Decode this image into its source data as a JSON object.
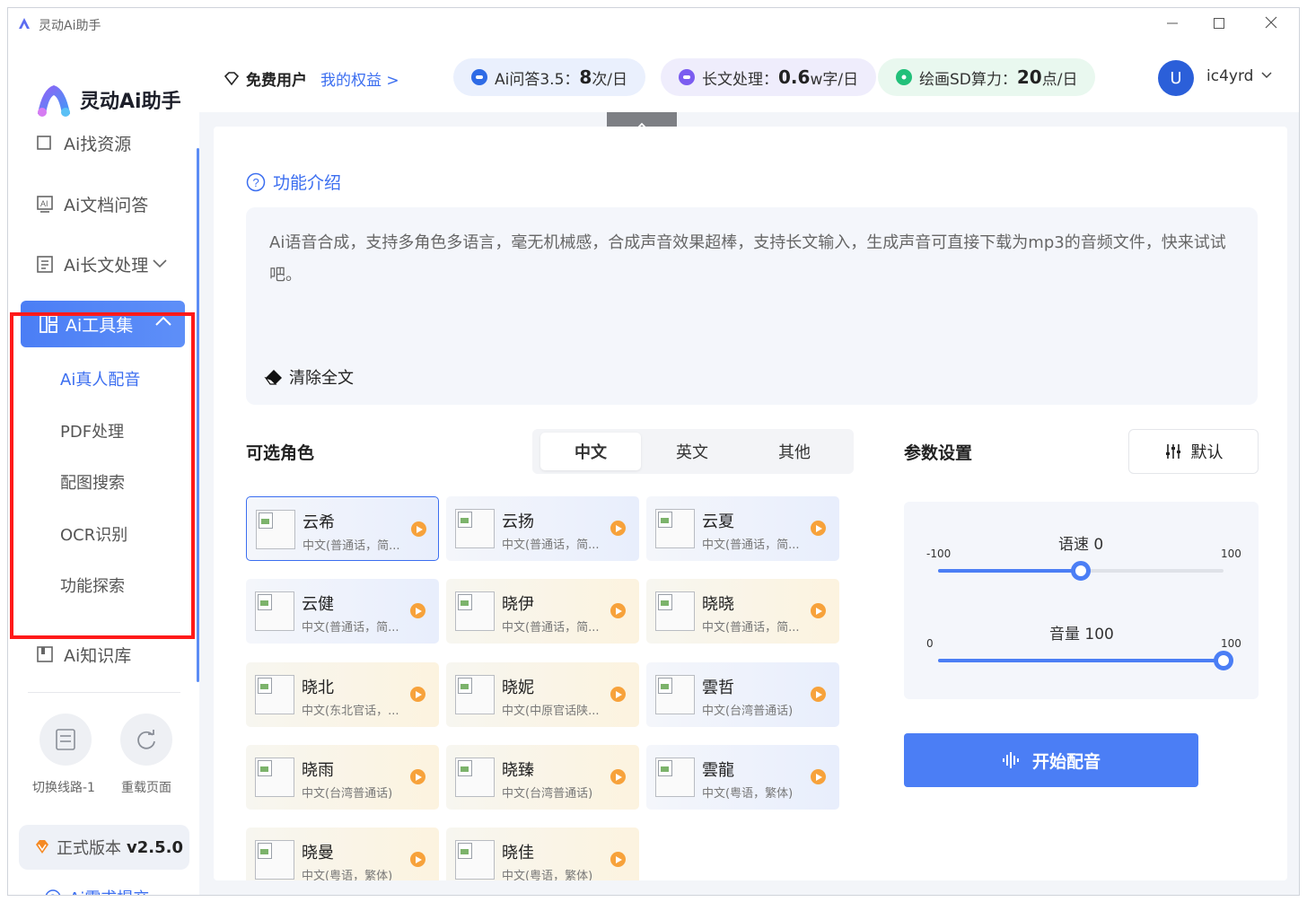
{
  "app": {
    "title": "灵动Ai助手",
    "logo_text": "灵动Ai助手"
  },
  "window_controls": [
    "minimize",
    "maximize",
    "close"
  ],
  "header": {
    "user_tier": "免费用户",
    "rights_link": "我的权益 >",
    "quotas": [
      {
        "label": "Ai问答3.5：",
        "value": "8",
        "unit": "次/日",
        "color": "#2e6be6",
        "bg": "#eaf0fd"
      },
      {
        "label": "长文处理：",
        "value": "0.6",
        "unit": "w字/日",
        "color": "#7b5cf0",
        "bg": "#efedfc"
      },
      {
        "label": "绘画SD算力：",
        "value": "20",
        "unit": "点/日",
        "color": "#22c07a",
        "bg": "#e9f8ef"
      }
    ],
    "avatar_letter": "U",
    "username": "ic4yrd"
  },
  "sidebar": {
    "items": [
      {
        "label": "Ai找资源",
        "icon": "search-icon"
      },
      {
        "label": "Ai文档问答",
        "icon": "document-ai-icon"
      },
      {
        "label": "Ai长文处理",
        "icon": "long-text-icon"
      },
      {
        "label": "Ai工具集",
        "icon": "grid-icon"
      },
      {
        "label": "Ai知识库",
        "icon": "book-icon"
      }
    ],
    "sub_items": [
      "Ai真人配音",
      "PDF处理",
      "配图搜索",
      "OCR识别",
      "功能探索"
    ],
    "tools": [
      {
        "label": "切换线路-1",
        "icon": "switch-line-icon"
      },
      {
        "label": "重载页面",
        "icon": "reload-icon"
      }
    ],
    "version_label": "正式版本",
    "version": "v2.5.0",
    "feedback": "Ai需求提交"
  },
  "main": {
    "intro_title": "功能介绍",
    "intro_text": "Ai语音合成，支持多角色多语言，毫无机械感，合成声音效果超棒，支持长文输入，生成声音可直接下载为mp3的音频文件，快来试试吧。",
    "clear_button": "清除全文",
    "roles_title": "可选角色",
    "lang_tabs": [
      "中文",
      "英文",
      "其他"
    ],
    "active_lang": "中文",
    "voices": [
      {
        "name": "云希",
        "desc": "中文(普通话，简...",
        "tone": "blue"
      },
      {
        "name": "云扬",
        "desc": "中文(普通话，简...",
        "tone": "blue"
      },
      {
        "name": "云夏",
        "desc": "中文(普通话，简...",
        "tone": "blue"
      },
      {
        "name": "云健",
        "desc": "中文(普通话，简...",
        "tone": "blue"
      },
      {
        "name": "晓伊",
        "desc": "中文(普通话，简...",
        "tone": "yellow"
      },
      {
        "name": "晓晓",
        "desc": "中文(普通话，简...",
        "tone": "yellow"
      },
      {
        "name": "晓北",
        "desc": "中文(东北官话，...",
        "tone": "yellow"
      },
      {
        "name": "晓妮",
        "desc": "中文(中原官话陕...",
        "tone": "yellow"
      },
      {
        "name": "雲哲",
        "desc": "中文(台湾普通话)",
        "tone": "blue"
      },
      {
        "name": "晓雨",
        "desc": "中文(台湾普通话)",
        "tone": "yellow"
      },
      {
        "name": "晓臻",
        "desc": "中文(台湾普通话)",
        "tone": "yellow"
      },
      {
        "name": "雲龍",
        "desc": "中文(粤语，繁体)",
        "tone": "blue"
      },
      {
        "name": "晓曼",
        "desc": "中文(粤语，繁体)",
        "tone": "yellow"
      },
      {
        "name": "晓佳",
        "desc": "中文(粤语，繁体)",
        "tone": "yellow"
      }
    ],
    "params_title": "参数设置",
    "default_button": "默认",
    "speed": {
      "label": "语速 0",
      "min": "-100",
      "max": "100",
      "value": 0
    },
    "volume": {
      "label": "音量 100",
      "min": "0",
      "max": "100",
      "value": 100
    },
    "start_button": "开始配音"
  },
  "colors": {
    "accent": "#4b7ef5",
    "highlight_border": "#ff1a1a",
    "play": "#f7a23b"
  }
}
